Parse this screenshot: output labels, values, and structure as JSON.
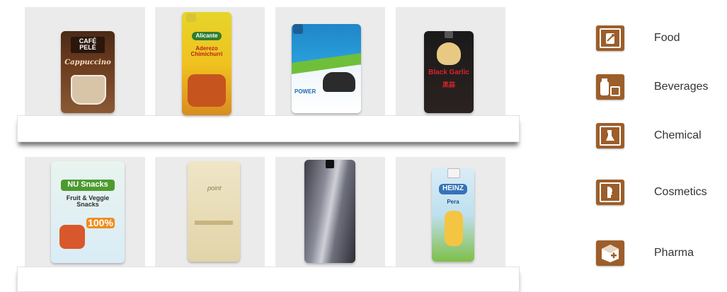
{
  "products": {
    "cafe": {
      "brand": "CAFÉ PELÉ",
      "name": "Cappuccino"
    },
    "sauce": {
      "brand": "Alicante",
      "name": "Aderezo Chimichurri"
    },
    "moto": {
      "brand": "POWER"
    },
    "garlic": {
      "name": "Black Garlic",
      "sub": "黑蒜"
    },
    "snacks": {
      "brand": "NU Snacks",
      "name": "Fruit & Veggie Snacks",
      "badge": "100%"
    },
    "cream": {
      "brand": "point"
    },
    "foil": {},
    "heinz": {
      "brand": "HEINZ",
      "name": "Pera"
    }
  },
  "categories": [
    {
      "label": "Food",
      "icon": "food-icon"
    },
    {
      "label": "Beverages",
      "icon": "beverages-icon"
    },
    {
      "label": "Chemical",
      "icon": "chemical-icon"
    },
    {
      "label": "Cosmetics",
      "icon": "cosmetics-icon"
    },
    {
      "label": "Pharma",
      "icon": "pharma-icon"
    }
  ],
  "colors": {
    "accent": "#9c5e2b",
    "panel": "#ebebeb"
  }
}
